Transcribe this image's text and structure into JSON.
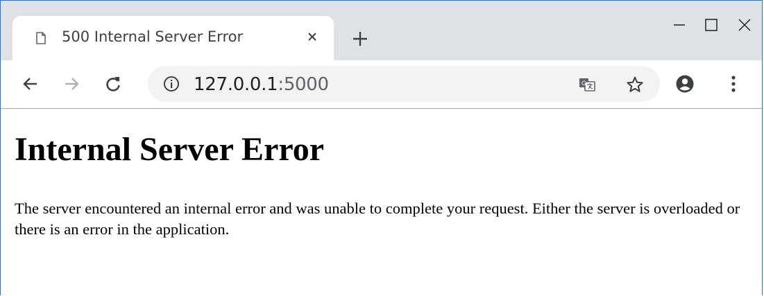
{
  "browser": {
    "tab": {
      "title": "500 Internal Server Error"
    },
    "url": {
      "host": "127.0.0.1",
      "port": ":5000"
    }
  },
  "page": {
    "heading": "Internal Server Error",
    "message": "The server encountered an internal error and was unable to complete your request. Either the server is overloaded or there is an error in the application."
  }
}
